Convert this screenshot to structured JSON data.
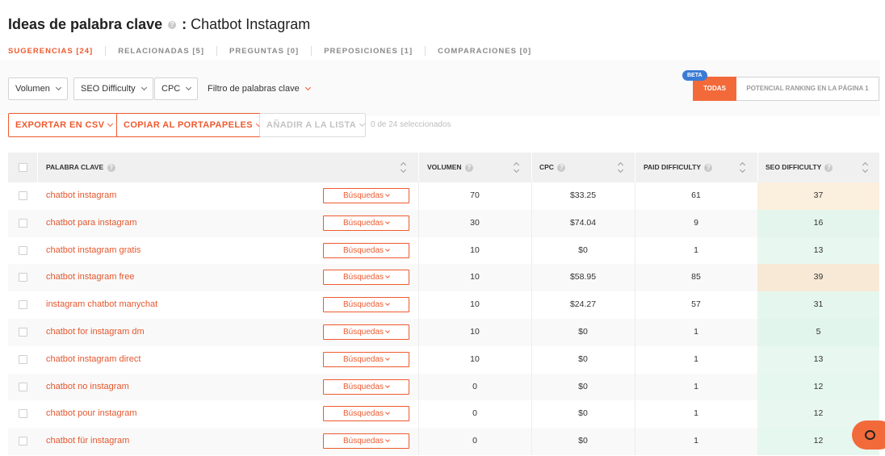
{
  "header": {
    "title_prefix": "Ideas de palabra clave",
    "title_sep": ":",
    "title_query": "Chatbot Instagram"
  },
  "tabs": [
    {
      "label": "SUGERENCIAS [24]",
      "active": true
    },
    {
      "label": "RELACIONADAS [5]",
      "active": false
    },
    {
      "label": "PREGUNTAS [0]",
      "active": false
    },
    {
      "label": "PREPOSICIONES [1]",
      "active": false
    },
    {
      "label": "COMPARACIONES [0]",
      "active": false
    }
  ],
  "filters": {
    "volumen": "Volumen",
    "seo_difficulty": "SEO Difficulty",
    "cpc": "CPC",
    "keyword_filter": "Filtro de palabras clave"
  },
  "view_toggle": {
    "beta": "BETA",
    "todas": "TODAS",
    "potencial": "POTENCIAL RANKING EN LA PÁGINA 1"
  },
  "actions": {
    "export_csv": "EXPORTAR EN CSV",
    "copy_clipboard": "COPIAR AL PORTAPAPELES",
    "add_list": "AÑADIR A LA LISTA",
    "selected_count": "0 de 24 seleccionados"
  },
  "table": {
    "headers": {
      "keyword": "PALABRA CLAVE",
      "volume": "VOLUMEN",
      "cpc": "CPC",
      "paid_difficulty": "PAID DIFFICULTY",
      "seo_difficulty": "SEO DIFFICULTY"
    },
    "search_button_label": "Búsquedas",
    "rows": [
      {
        "keyword": "chatbot instagram",
        "volume": "70",
        "cpc": "$33.25",
        "paid": "61",
        "seo": "37"
      },
      {
        "keyword": "chatbot para instagram",
        "volume": "30",
        "cpc": "$74.04",
        "paid": "9",
        "seo": "16"
      },
      {
        "keyword": "chatbot instagram gratis",
        "volume": "10",
        "cpc": "$0",
        "paid": "1",
        "seo": "13"
      },
      {
        "keyword": "chatbot instagram free",
        "volume": "10",
        "cpc": "$58.95",
        "paid": "85",
        "seo": "39"
      },
      {
        "keyword": "instagram chatbot manychat",
        "volume": "10",
        "cpc": "$24.27",
        "paid": "57",
        "seo": "31"
      },
      {
        "keyword": "chatbot for instagram dm",
        "volume": "10",
        "cpc": "$0",
        "paid": "1",
        "seo": "5"
      },
      {
        "keyword": "chatbot instagram direct",
        "volume": "10",
        "cpc": "$0",
        "paid": "1",
        "seo": "13"
      },
      {
        "keyword": "chatbot no instagram",
        "volume": "0",
        "cpc": "$0",
        "paid": "1",
        "seo": "12"
      },
      {
        "keyword": "chatbot pour instagram",
        "volume": "0",
        "cpc": "$0",
        "paid": "1",
        "seo": "12"
      },
      {
        "keyword": "chatbot für instagram",
        "volume": "0",
        "cpc": "$0",
        "paid": "1",
        "seo": "12"
      }
    ]
  },
  "colors": {
    "accent": "#ef5a2f",
    "seo_easy": "#e6f6ef",
    "seo_medium": "#fbeedb"
  }
}
